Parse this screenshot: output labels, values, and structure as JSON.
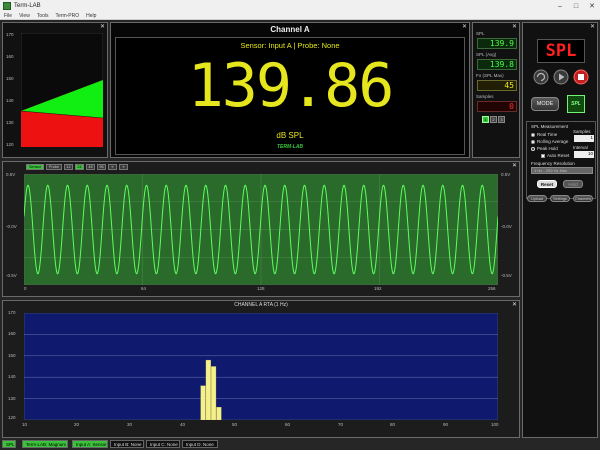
{
  "window": {
    "title": "Term-LAB",
    "min": "–",
    "max": "□",
    "close": "✕"
  },
  "menu": [
    "File",
    "View",
    "Tools",
    "Term-PRO",
    "Help"
  ],
  "level_meter": {
    "ticks": [
      "170",
      "160",
      "150",
      "140",
      "130",
      "120"
    ],
    "value": 139.86
  },
  "channel": {
    "title": "Channel A",
    "sensor_line": "Sensor: Input A | Probe: None",
    "reading": "139.86",
    "unit": "dB SPL",
    "logo": "TERM-LAB"
  },
  "readouts": {
    "spl_label": "SPL",
    "spl_value": "139.9",
    "spl_avg_label": "SPL (Avg)",
    "spl_avg_value": "139.8",
    "fo_label": "Fo (SPL Max)",
    "fo_value": "45",
    "samples_label": "Samples",
    "samples_value": "0",
    "page_buttons": [
      "1",
      "2",
      "3"
    ]
  },
  "controls": {
    "spl_badge": "SPL",
    "mode_button": "MODE",
    "mode_badge": "SPL",
    "measurement_title": "SPL Measurement",
    "samples_label": "Samples",
    "samples_value": "1",
    "interval_label": "Interval",
    "interval_value": "10",
    "options": [
      "Real Time",
      "Rolling Average",
      "Peak Hold"
    ],
    "auto_reset_label": "Auto Reset",
    "freq_res_title": "Frequency Resolution",
    "freq_res_value": "1 Hz - 200 Hz Max",
    "reset_button": "Reset",
    "hold_button": "Hold",
    "bottom_buttons": [
      "Upload",
      "Settings",
      "Channels"
    ]
  },
  "waveform": {
    "tabs": [
      "Sensor",
      "Probe",
      "12",
      "24",
      "48",
      "96",
      "≡",
      "≡"
    ],
    "y_left": [
      "0.5V",
      "-0.0V",
      "-0.5V"
    ],
    "y_right": [
      "0.5V",
      "-0.0V",
      "-0.5V"
    ],
    "x_ticks": [
      "0",
      "64",
      "128",
      "192",
      "256"
    ],
    "chart_data": {
      "type": "line",
      "ylim": [
        -0.5,
        0.5
      ],
      "xlim": [
        0,
        256
      ],
      "cycles": 24
    }
  },
  "rta": {
    "title": "CHANNEL A RTA (1 Hz)",
    "y_ticks": [
      "170",
      "160",
      "150",
      "140",
      "130",
      "120"
    ],
    "x_ticks": [
      "10",
      "20",
      "30",
      "40",
      "50",
      "60",
      "70",
      "80",
      "90",
      "100"
    ],
    "chart_data": {
      "type": "bar",
      "title": "CHANNEL A RTA (1 Hz)",
      "ylim": [
        120,
        170
      ],
      "xlim": [
        10,
        100
      ],
      "x": [
        44,
        45,
        46,
        47
      ],
      "values": [
        136,
        148,
        145,
        126
      ]
    }
  },
  "status_bar": [
    "SPL",
    "Term-LAB: Magnum",
    "Input A: Sensor",
    "Input B: None",
    "Input C: None",
    "Input D: None"
  ],
  "colors": {
    "accent_green": "#22dd22",
    "accent_yellow": "#e6e61e",
    "accent_red": "#ff2a2a",
    "rta_bg": "#0f1a6e",
    "scope_bg": "#2a6a2a"
  }
}
